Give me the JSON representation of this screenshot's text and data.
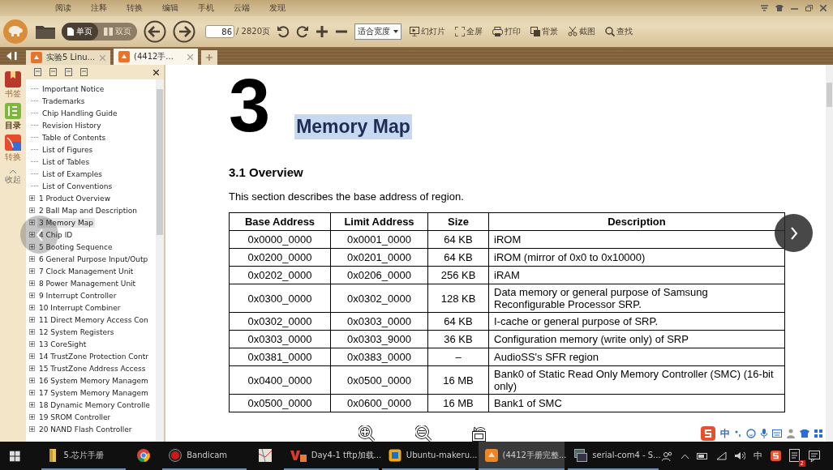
{
  "menu_tabs": [
    {
      "label": "阅读"
    },
    {
      "label": "注释"
    },
    {
      "label": "转换"
    },
    {
      "label": "编辑"
    },
    {
      "label": "手机"
    },
    {
      "label": "云端"
    },
    {
      "label": "发现"
    }
  ],
  "toolbar": {
    "view_modes": [
      {
        "label": "单页",
        "selected": true
      },
      {
        "label": "双页",
        "selected": false
      }
    ],
    "page": {
      "value": "86",
      "total": "/ 2820页"
    },
    "zoom": "适合宽度",
    "actions": [
      {
        "label": "幻灯片",
        "kind": "slides"
      },
      {
        "label": "全屏",
        "kind": "fullscreen"
      },
      {
        "label": "打印",
        "kind": "print"
      },
      {
        "label": "背景",
        "kind": "background"
      },
      {
        "label": "截图",
        "kind": "scissors"
      },
      {
        "label": "查找",
        "kind": "search"
      }
    ]
  },
  "tabs": [
    {
      "label": "实验5 Linu...",
      "selected": false
    },
    {
      "label": "(4412手...",
      "selected": true
    }
  ],
  "rail": [
    {
      "label": "书签",
      "kind": "bookmark",
      "selected": false
    },
    {
      "label": "目录",
      "kind": "contents",
      "selected": true
    },
    {
      "label": "转换",
      "kind": "convert",
      "selected": false
    },
    {
      "label": "收起",
      "kind": "collapse",
      "selected": false
    }
  ],
  "outline": [
    {
      "label": "Important Notice",
      "kind": "leaf",
      "selected": false
    },
    {
      "label": "Trademarks",
      "kind": "leaf",
      "selected": false
    },
    {
      "label": "Chip Handling Guide",
      "kind": "leaf",
      "selected": false
    },
    {
      "label": "Revision History",
      "kind": "leaf",
      "selected": false
    },
    {
      "label": "Table of Contents",
      "kind": "leaf",
      "selected": false
    },
    {
      "label": "List of Figures",
      "kind": "leaf",
      "selected": false
    },
    {
      "label": "List of Tables",
      "kind": "leaf",
      "selected": false
    },
    {
      "label": "List of Examples",
      "kind": "leaf",
      "selected": false
    },
    {
      "label": "List of Conventions",
      "kind": "leaf",
      "selected": false
    },
    {
      "label": "1 Product Overview",
      "kind": "collapsed",
      "selected": false
    },
    {
      "label": "2 Ball Map and Description",
      "kind": "collapsed",
      "selected": false
    },
    {
      "label": "3 Memory Map",
      "kind": "collapsed",
      "selected": true
    },
    {
      "label": "4 Chip ID",
      "kind": "collapsed",
      "selected": false
    },
    {
      "label": "5 Booting Sequence",
      "kind": "collapsed",
      "selected": false
    },
    {
      "label": "6 General Purpose Input/Outp",
      "kind": "collapsed",
      "selected": false
    },
    {
      "label": "7 Clock Management Unit",
      "kind": "collapsed",
      "selected": false
    },
    {
      "label": "8 Power Management Unit",
      "kind": "collapsed",
      "selected": false
    },
    {
      "label": "9 Interrupt Controller",
      "kind": "collapsed",
      "selected": false
    },
    {
      "label": "10 Interrupt Combiner",
      "kind": "collapsed",
      "selected": false
    },
    {
      "label": "11 Direct Memory Access Con",
      "kind": "collapsed",
      "selected": false
    },
    {
      "label": "12 System Registers",
      "kind": "collapsed",
      "selected": false
    },
    {
      "label": "13 CoreSight",
      "kind": "collapsed",
      "selected": false
    },
    {
      "label": "14 TrustZone Protection Contr",
      "kind": "collapsed",
      "selected": false
    },
    {
      "label": "15 TrustZone Address Access",
      "kind": "collapsed",
      "selected": false
    },
    {
      "label": "16 System Memory Managem",
      "kind": "collapsed",
      "selected": false
    },
    {
      "label": "17 System Memory Managem",
      "kind": "collapsed",
      "selected": false
    },
    {
      "label": "18 Dynamic Memory Controlle",
      "kind": "collapsed",
      "selected": false
    },
    {
      "label": "19 SROM Controller",
      "kind": "collapsed",
      "selected": false
    },
    {
      "label": "20 NAND Flash Controller",
      "kind": "collapsed",
      "selected": false
    }
  ],
  "document": {
    "chapter_number": "3",
    "chapter_title": "Memory Map",
    "title_highlighted": true,
    "section_title": "3.1 Overview",
    "paragraph": "This section describes the base address of region.",
    "table": {
      "columns": [
        "Base Address",
        "Limit Address",
        "Size",
        "Description"
      ],
      "rows": [
        [
          "0x0000_0000",
          "0x0001_0000",
          "64 KB",
          "iROM"
        ],
        [
          "0x0200_0000",
          "0x0201_0000",
          "64 KB",
          "iROM (mirror of 0x0 to 0x10000)"
        ],
        [
          "0x0202_0000",
          "0x0206_0000",
          "256 KB",
          "iRAM"
        ],
        [
          "0x0300_0000",
          "0x0302_0000",
          "128 KB",
          "Data memory or general purpose of Samsung Reconfigurable Processor SRP."
        ],
        [
          "0x0302_0000",
          "0x0303_0000",
          "64 KB",
          "I-cache or general purpose of SRP."
        ],
        [
          "0x0303_0000",
          "0x0303_9000",
          "36 KB",
          "Configuration memory (write only) of SRP"
        ],
        [
          "0x0381_0000",
          "0x0383_0000",
          "–",
          "AudioSS's SFR region"
        ],
        [
          "0x0400_0000",
          "0x0500_0000",
          "16 MB",
          "Bank0 of Static Read Only Memory Controller (SMC) (16-bit only)"
        ],
        [
          "0x0500_0000",
          "0x0600_0000",
          "16 MB",
          "Bank1 of SMC"
        ]
      ]
    }
  },
  "ime_bar": {
    "mode": "中"
  },
  "taskbar": {
    "items": [
      {
        "label": "5.芯片手册",
        "kind": "folder",
        "selected": false
      },
      {
        "kind": "chrome",
        "selected": false
      },
      {
        "label": "Bandicam",
        "kind": "record",
        "selected": false
      },
      {
        "kind": "photo",
        "selected": false
      },
      {
        "label": "Day4-1 tftp加载...",
        "kind": "video",
        "selected": false
      },
      {
        "label": "Ubuntu-makeru...",
        "kind": "vm",
        "selected": false
      },
      {
        "label": "(4412手册完整...",
        "kind": "reader",
        "selected": true
      },
      {
        "label": "serial-com4 - S...",
        "kind": "terminal",
        "selected": false
      }
    ],
    "input_mode": "中",
    "notification_count": "2"
  }
}
